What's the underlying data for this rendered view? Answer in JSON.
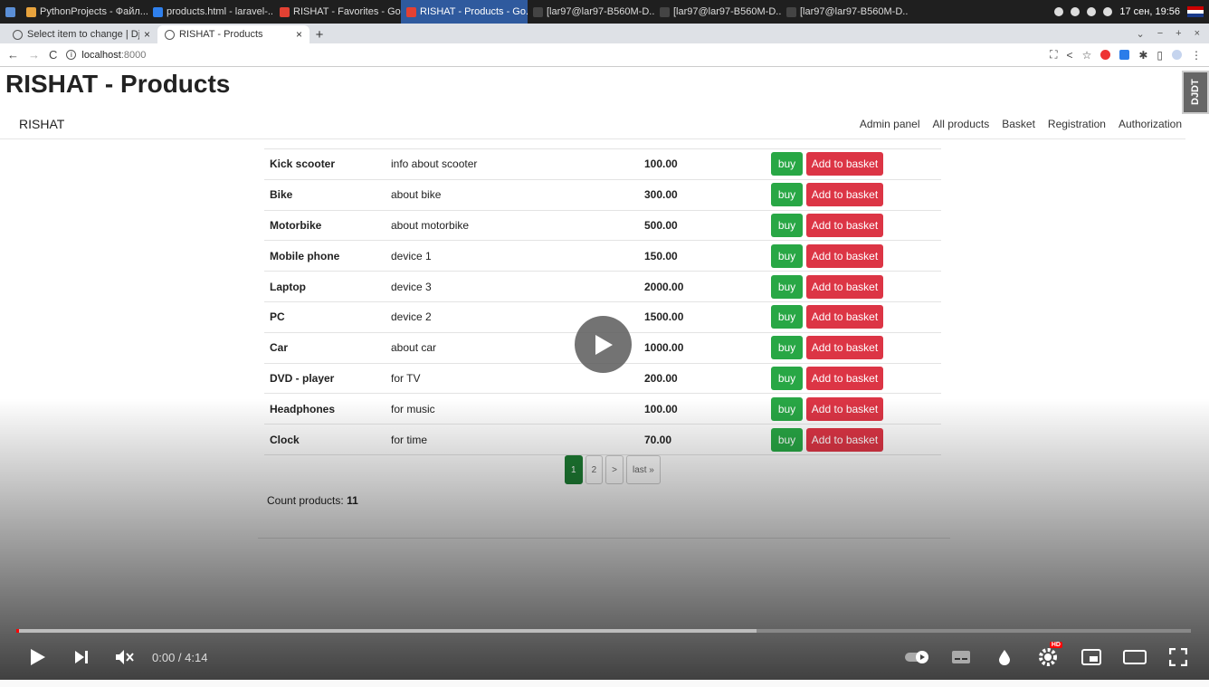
{
  "taskbar": {
    "items": [
      {
        "label": "PythonProjects - Файл...",
        "color": "#e8a33d"
      },
      {
        "label": "products.html - laravel-...",
        "color": "#2f80ed"
      },
      {
        "label": "RISHAT - Favorites - Go...",
        "color": "#e34133"
      },
      {
        "label": "RISHAT - Products - Go...",
        "color": "#e34133",
        "active": true
      },
      {
        "label": "[lar97@lar97-B560M-D...",
        "color": "#444"
      },
      {
        "label": "[lar97@lar97-B560M-D...",
        "color": "#444"
      },
      {
        "label": "[lar97@lar97-B560M-D...",
        "color": "#444"
      }
    ],
    "clock": "17 сен, 19:56"
  },
  "browser": {
    "tabs": [
      {
        "title": "Select item to change | Dj..."
      },
      {
        "title": "RISHAT - Products",
        "active": true
      }
    ],
    "url_host": "localhost",
    "url_port": ":8000"
  },
  "page": {
    "title": "RISHAT - Products",
    "brand": "RISHAT",
    "nav": [
      "Admin panel",
      "All products",
      "Basket",
      "Registration",
      "Authorization"
    ],
    "djdt_label": "DJDT",
    "buy_label": "buy",
    "basket_label": "Add to basket",
    "products": [
      {
        "name": "Kick scooter",
        "desc": "info about scooter",
        "price": "100.00"
      },
      {
        "name": "Bike",
        "desc": "about bike",
        "price": "300.00"
      },
      {
        "name": "Motorbike",
        "desc": "about motorbike",
        "price": "500.00"
      },
      {
        "name": "Mobile phone",
        "desc": "device 1",
        "price": "150.00"
      },
      {
        "name": "Laptop",
        "desc": "device 3",
        "price": "2000.00"
      },
      {
        "name": "PC",
        "desc": "device 2",
        "price": "1500.00"
      },
      {
        "name": "Car",
        "desc": "about car",
        "price": "1000.00"
      },
      {
        "name": "DVD - player",
        "desc": "for TV",
        "price": "200.00"
      },
      {
        "name": "Headphones",
        "desc": "for music",
        "price": "100.00"
      },
      {
        "name": "Clock",
        "desc": "for time",
        "price": "70.00"
      }
    ],
    "pagination": [
      "1",
      "2",
      ">",
      "last »"
    ],
    "count_label": "Count products:",
    "count_value": "11"
  },
  "player": {
    "time": "0:00 / 4:14",
    "buffered_fraction": 0.63,
    "played_fraction": 0.0,
    "hd_badge": "HD",
    "accent": "#ff0000"
  }
}
